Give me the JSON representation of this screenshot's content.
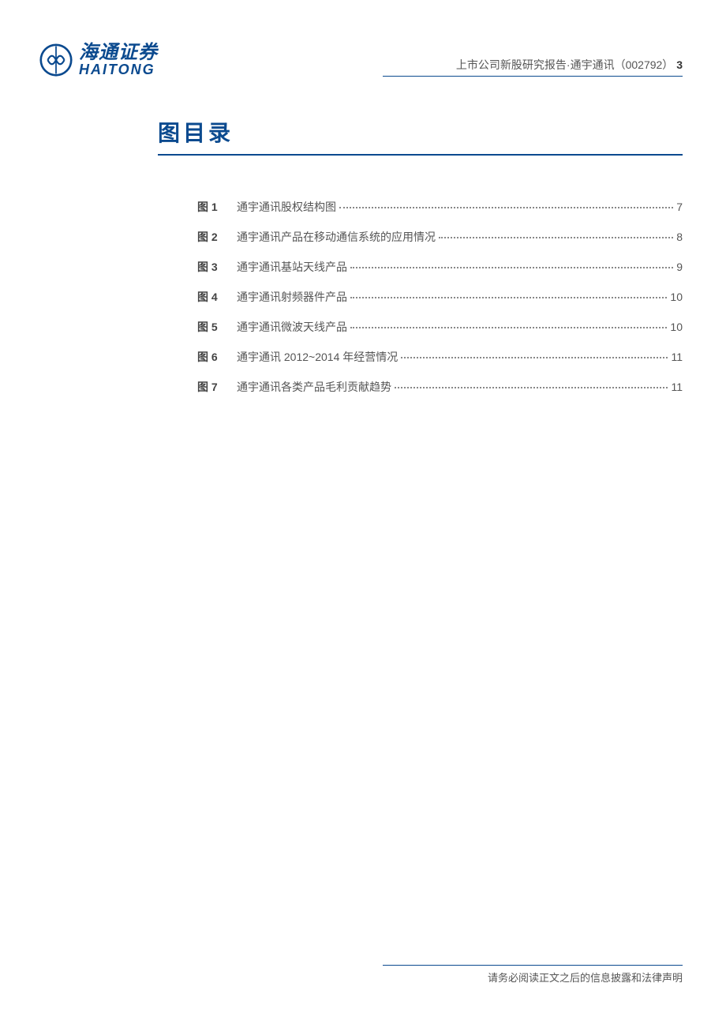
{
  "header": {
    "logo_cn": "海通证券",
    "logo_en": "HAITONG",
    "right_text": "上市公司新股研究报告·通宇通讯（002792）",
    "page_num": "3"
  },
  "title": "图目录",
  "toc": [
    {
      "label": "图 1",
      "desc": "通宇通讯股权结构图",
      "page": "7"
    },
    {
      "label": "图 2",
      "desc": "通宇通讯产品在移动通信系统的应用情况",
      "page": "8"
    },
    {
      "label": "图 3",
      "desc": "通宇通讯基站天线产品",
      "page": "9"
    },
    {
      "label": "图 4",
      "desc": "通宇通讯射频器件产品",
      "page": "10"
    },
    {
      "label": "图 5",
      "desc": "通宇通讯微波天线产品",
      "page": "10"
    },
    {
      "label": "图 6",
      "desc": "通宇通讯 2012~2014 年经营情况",
      "page": "11"
    },
    {
      "label": "图 7",
      "desc": "通宇通讯各类产品毛利贡献趋势",
      "page": "11"
    }
  ],
  "footer": "请务必阅读正文之后的信息披露和法律声明"
}
